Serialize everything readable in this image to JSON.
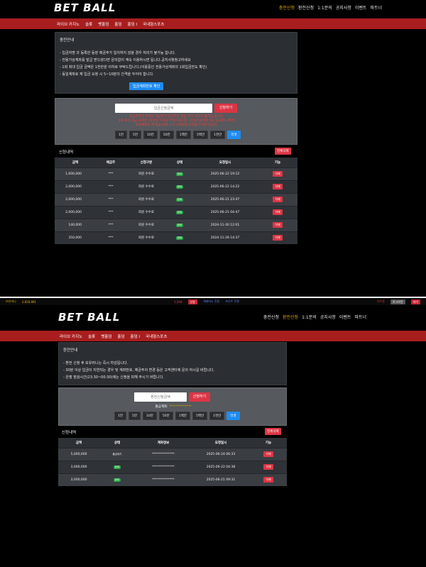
{
  "brand": {
    "logo": "BET BALL"
  },
  "top": {
    "nav": [
      {
        "label": "충전신청",
        "active": true
      },
      {
        "label": "환전신청",
        "active": false
      },
      {
        "label": "1:1문의",
        "active": false
      },
      {
        "label": "공지사항",
        "active": false
      },
      {
        "label": "이벤트",
        "active": false
      },
      {
        "label": "파트너",
        "active": false
      }
    ],
    "gamenav": [
      "라이브 카지노",
      "슬롯",
      "벳홀덤",
      "홀덤",
      "홀덤 I",
      "국내형스포츠"
    ],
    "notice": {
      "title": "충전안내",
      "lines": [
        "- 입금자명 과 등록한 등장 예금주가 일치하지 않을 경우 처리가 불가능 합니다.",
        "- 전용가상계좌를 발급 받으셨다면 문의없이 계속 이용하시면 됩니다.공지사항참고하세요",
        "- 1회 최대 입금 금액은 1천만원 이하로 부탁드립니다.(이용중인 전용가상계좌의 1회입금한도 확인)",
        "- 동일계좌로 재 입금 요청 시 5~10분의 간격을 두어야 합니다."
      ],
      "confirm_button": "입금계좌번호 확인"
    },
    "form": {
      "placeholder": "입금신청금액",
      "submit": "신청하기",
      "warnings": [
        "입금자명과 등록된 예금주가 일치하지 않을 경우 처리가 불가능 합니다.",
        "1회 최대 입금 금액은 1천만원 이하로 부탁드립니다. (전용가상계좌 1회 입금한도 확인)",
        "동일계좌로 재 입금 요청 시 5~10분의 간격을 두어야 합니다."
      ],
      "chips": [
        "1만",
        "5만",
        "10만",
        "50만",
        "1백만",
        "5백만",
        "1천만",
        "리셋"
      ]
    },
    "history": {
      "title": "신청내역",
      "delete_all": "전체삭제",
      "columns": [
        "금액",
        "예금주",
        "신청구분",
        "상태",
        "요청일시",
        "기능"
      ],
      "rows": [
        {
          "amount": "1,000,000",
          "holder": "***",
          "type": "회원 수수료",
          "status": "완료",
          "date": "2025-06-22 19:12",
          "action": "삭제"
        },
        {
          "amount": "2,000,000",
          "holder": "***",
          "type": "회원 수수료",
          "status": "완료",
          "date": "2025-06-22 14:22",
          "action": "삭제"
        },
        {
          "amount": "2,000,000",
          "holder": "***",
          "type": "회원 수수료",
          "status": "완료",
          "date": "2025-06-21 23:47",
          "action": "삭제"
        },
        {
          "amount": "2,000,000",
          "holder": "***",
          "type": "회원 수수료",
          "status": "완료",
          "date": "2025-06-21 04:47",
          "action": "삭제"
        },
        {
          "amount": "140,000",
          "holder": "***",
          "type": "회원 수수료",
          "status": "완료",
          "date": "2024-11-30 12:01",
          "action": "삭제"
        },
        {
          "amount": "350,000",
          "holder": "***",
          "type": "회원 수수료",
          "status": "완료",
          "date": "2024-11-28 14:37",
          "action": "삭제"
        }
      ]
    }
  },
  "strip": {
    "balance_label": "보유머니",
    "balance": "2,828,881",
    "point": "1,568",
    "apply": "신청",
    "item1": "개별머니 전환",
    "item2": "포인트 전환",
    "user": "기수준",
    "logout": "로그아웃",
    "mypage": "마이"
  },
  "bottom": {
    "nav": [
      {
        "label": "충전신청",
        "active": false
      },
      {
        "label": "환전신청",
        "active": true
      },
      {
        "label": "1:1문의",
        "active": false
      },
      {
        "label": "공지사항",
        "active": false
      },
      {
        "label": "이벤트",
        "active": false
      },
      {
        "label": "파트너",
        "active": false
      }
    ],
    "gamenav": [
      "라이브 카지노",
      "슬롯",
      "벳홀덤",
      "홀덤",
      "홀덤 I",
      "국내형스포츠"
    ],
    "notice": {
      "title": "환전안내",
      "lines": [
        "- 환전 신청 후 보유머니는 즉시 차감됩니다.",
        "- 30분 이상 입금이 지연되는 경우 및 계좌번호, 예금주의 변경 등은 고객센터에 문의 하시길 바랍니다.",
        "- 은행 점검시간(23:30~00:30)에는 신청을 피해 주시기 바랍니다."
      ]
    },
    "form": {
      "placeholder": "환전신청금액",
      "submit": "신청하기",
      "account_label": "출금계좌:",
      "account_value": "**************",
      "chips": [
        "1만",
        "5만",
        "10만",
        "50만",
        "1백만",
        "5백만",
        "1천만",
        "리셋"
      ]
    },
    "history": {
      "title": "신청내역",
      "delete_all": "전체삭제",
      "columns": [
        "금액",
        "상태",
        "계좌정보",
        "요청일시",
        "기능"
      ],
      "rows": [
        {
          "amount": "5,000,000",
          "status": "출금대기",
          "account": "**************",
          "date": "2025-06-24 06:33",
          "action": "삭제"
        },
        {
          "amount": "3,000,000",
          "status": "완료",
          "account": "**************",
          "date": "2025-06-22 04:38",
          "action": "삭제"
        },
        {
          "amount": "3,000,000",
          "status": "완료",
          "account": "**************",
          "date": "2025-06-21 09:31",
          "action": "삭제"
        }
      ]
    }
  },
  "colors": {
    "accent_red": "#a81e1e",
    "button_red": "#dc3545",
    "button_blue": "#1e8cf0",
    "active_nav": "#e0b000",
    "status_green": "#28a745"
  }
}
